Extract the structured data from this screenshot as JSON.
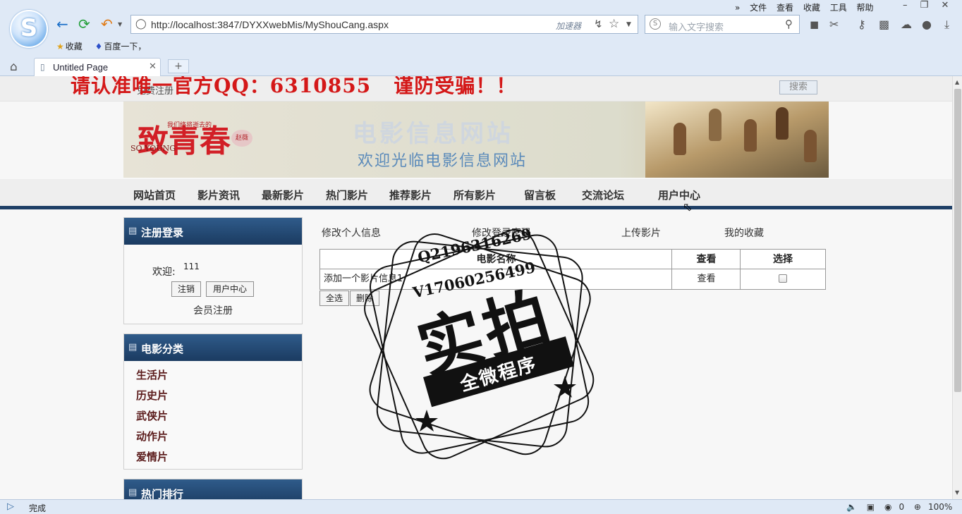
{
  "browser": {
    "url": "http://localhost:3847/DYXXwebMis/MyShouCang.aspx",
    "accelerator_label": "加速器",
    "search_placeholder": "输入文字搜索",
    "menus": [
      "文件",
      "查看",
      "收藏",
      "工具",
      "帮助"
    ],
    "favorites": [
      "收藏",
      "百度一下，"
    ],
    "tab_title": "Untitled Page",
    "status_text": "完成",
    "status_count": "0",
    "zoom": "100%"
  },
  "page": {
    "warning_text": "请认准唯一官方QQ：6310855   谨防受骗！！",
    "register_link": "免费注册",
    "search_button": "搜索",
    "banner": {
      "logo_text": "致青春",
      "logo_sub": "我们终将逝去的",
      "logo_en": "SO YOUNG",
      "logo_seal": "赵薇",
      "title": "电影信息网站",
      "welcome": "欢迎光临电影信息网站"
    },
    "nav": [
      "网站首页",
      "影片资讯",
      "最新影片",
      "热门影片",
      "推荐影片",
      "所有影片",
      "留言板",
      "交流论坛",
      "用户中心"
    ],
    "login_box": {
      "title": "注册登录",
      "welcome_label": "欢迎:",
      "username": "111",
      "logout_button": "注销",
      "user_center_button": "用户中心",
      "register_link": "会员注册"
    },
    "category_box": {
      "title": "电影分类",
      "items": [
        "生活片",
        "历史片",
        "武侠片",
        "动作片",
        "爱情片"
      ]
    },
    "ranking_box": {
      "title": "热门排行"
    },
    "content_links": [
      "修改个人信息",
      "修改登录密码",
      "上传影片",
      "我的收藏"
    ],
    "table": {
      "headers": [
        "电影名称",
        "查看",
        "选择"
      ],
      "rows": [
        {
          "name": "添加一个影片信息1",
          "view": "查看",
          "selected": false
        }
      ]
    },
    "select_all_button": "全选",
    "delete_button": "删除"
  },
  "watermark": {
    "qq": "Q2196316269",
    "wx": "V17060256499",
    "big_text": "实拍",
    "ribbon_text": "全微程序"
  }
}
